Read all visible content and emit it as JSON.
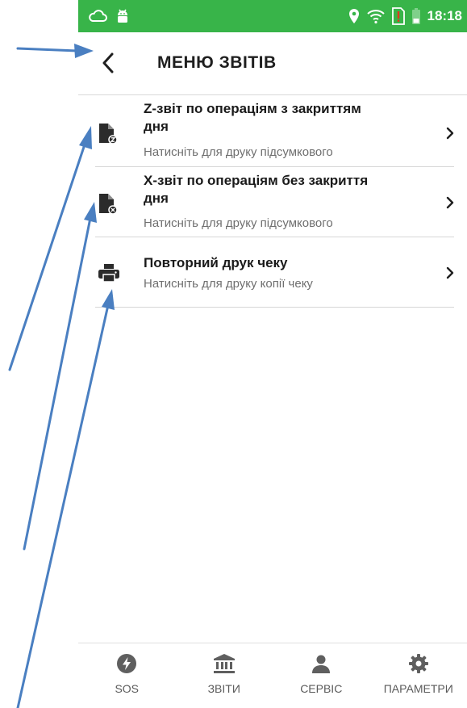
{
  "status_bar": {
    "time": "18:18",
    "icons": [
      "cloud-icon",
      "android-icon",
      "location-icon",
      "wifi-icon",
      "sim-alert-icon",
      "battery-icon"
    ]
  },
  "header": {
    "back_icon": "chevron-left-icon",
    "title": "МЕНЮ ЗВІТІВ"
  },
  "menu": {
    "items": [
      {
        "icon": "z-report-icon",
        "title": "Z-звіт по операціям з закриттям дня",
        "subtitle": "Натисніть для друку підсумкового"
      },
      {
        "icon": "x-report-icon",
        "title": "X-звіт по операціям без закриття дня",
        "subtitle": "Натисніть для друку підсумкового"
      },
      {
        "icon": "printer-icon",
        "title": "Повторний друк чеку",
        "subtitle": "Натисніть для друку копії чеку"
      }
    ]
  },
  "bottom_nav": {
    "items": [
      {
        "icon": "lightning-icon",
        "label": "SOS"
      },
      {
        "icon": "bank-icon",
        "label": "ЗВІТИ"
      },
      {
        "icon": "person-icon",
        "label": "СЕРВІС"
      },
      {
        "icon": "gear-icon",
        "label": "ПАРАМЕТРИ"
      }
    ]
  },
  "colors": {
    "status_bar": "#38b449",
    "annotation_arrow": "#4a7fc1",
    "icon": "#2b2b2b",
    "nav_icon": "#5f5f5f"
  }
}
